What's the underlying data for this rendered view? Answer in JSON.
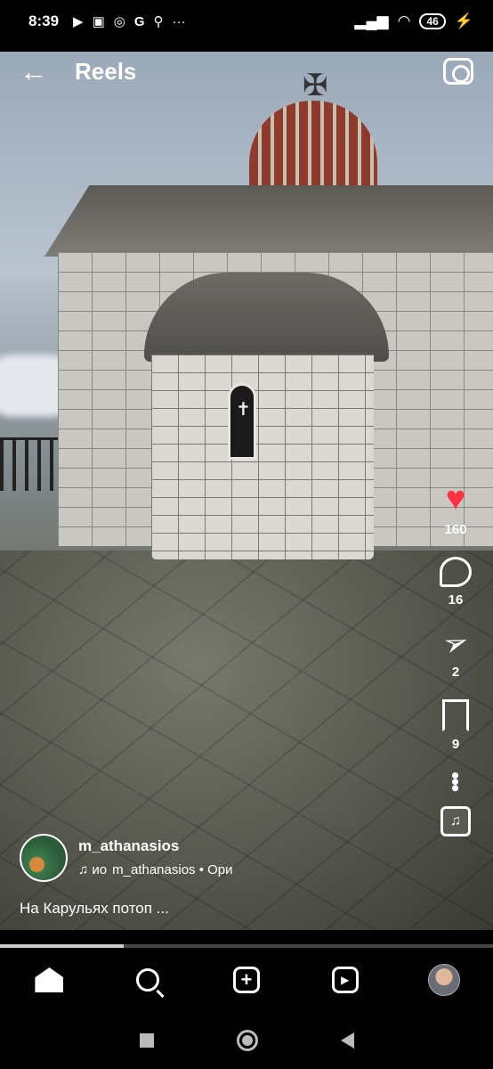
{
  "status_bar": {
    "time": "8:39",
    "left_icons": [
      "play-icon",
      "youtube-icon",
      "mi-icon",
      "google-icon",
      "keyhole-icon",
      "more-dots-icon"
    ],
    "battery": "46"
  },
  "header": {
    "title": "Reels"
  },
  "actions": {
    "likes": "160",
    "comments": "16",
    "shares": "2",
    "saves": "9"
  },
  "author": {
    "username": "m_athanasios",
    "audio_note": "♫ ио",
    "audio_text": "m_athanasios • Ори"
  },
  "caption": "На Карульях потоп ...",
  "progress": 0.25,
  "colors": {
    "like": "#ff3040",
    "background": "#000000"
  },
  "nav": [
    "home-icon",
    "search-icon",
    "create-icon",
    "reels-icon",
    "profile-avatar"
  ]
}
